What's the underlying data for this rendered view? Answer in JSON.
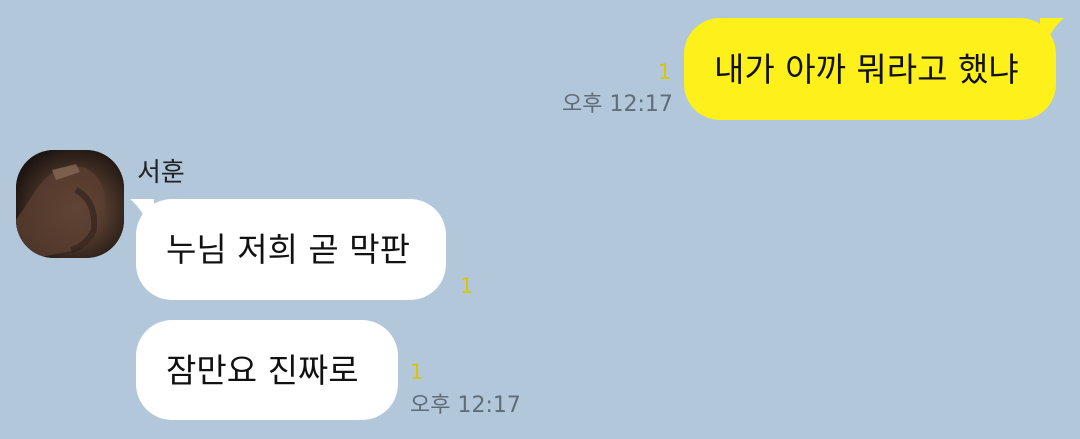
{
  "messages": [
    {
      "direction": "out",
      "text": "내가 아까 뭐라고 했냐",
      "unread": "1",
      "time": "오후 12:17"
    },
    {
      "direction": "in",
      "sender": "서훈",
      "text": "누님 저희 곧 막판",
      "unread": "1"
    },
    {
      "direction": "in",
      "text": "잠만요 진짜로",
      "unread": "1",
      "time": "오후 12:17"
    }
  ],
  "colors": {
    "background": "#b2c7da",
    "my_bubble": "#fef01b",
    "their_bubble": "#ffffff",
    "unread_count": "#d9c600",
    "timestamp": "#5f6d79"
  },
  "icons": {
    "avatar": "profile-photo"
  }
}
